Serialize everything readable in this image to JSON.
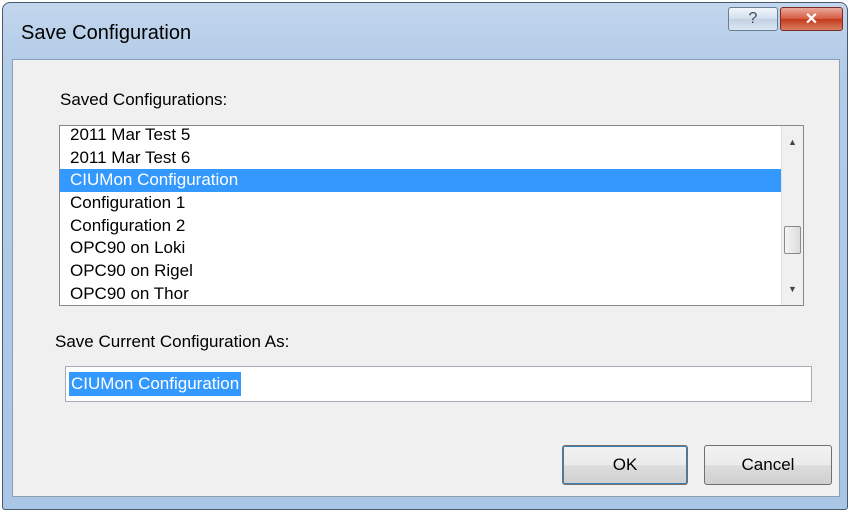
{
  "window": {
    "title": "Save Configuration",
    "help_glyph": "?",
    "close_glyph": "✕"
  },
  "saved_configs": {
    "label": "Saved Configurations:",
    "items": [
      "2011 Mar Test 5",
      "2011 Mar Test 6",
      "CIUMon Configuration",
      "Configuration 1",
      "Configuration 2",
      "OPC90 on Loki",
      "OPC90 on Rigel",
      "OPC90 on Thor"
    ],
    "selected_index": 2
  },
  "save_as": {
    "label": "Save Current Configuration As:",
    "value": "CIUMon Configuration"
  },
  "buttons": {
    "ok": "OK",
    "cancel": "Cancel"
  },
  "icons": {
    "help": "help-icon",
    "close": "close-icon",
    "scroll_up": "scroll-up-arrow-icon",
    "scroll_down": "scroll-down-arrow-icon"
  },
  "colors": {
    "selection": "#3399ff",
    "close_button": "#c43a1c"
  }
}
